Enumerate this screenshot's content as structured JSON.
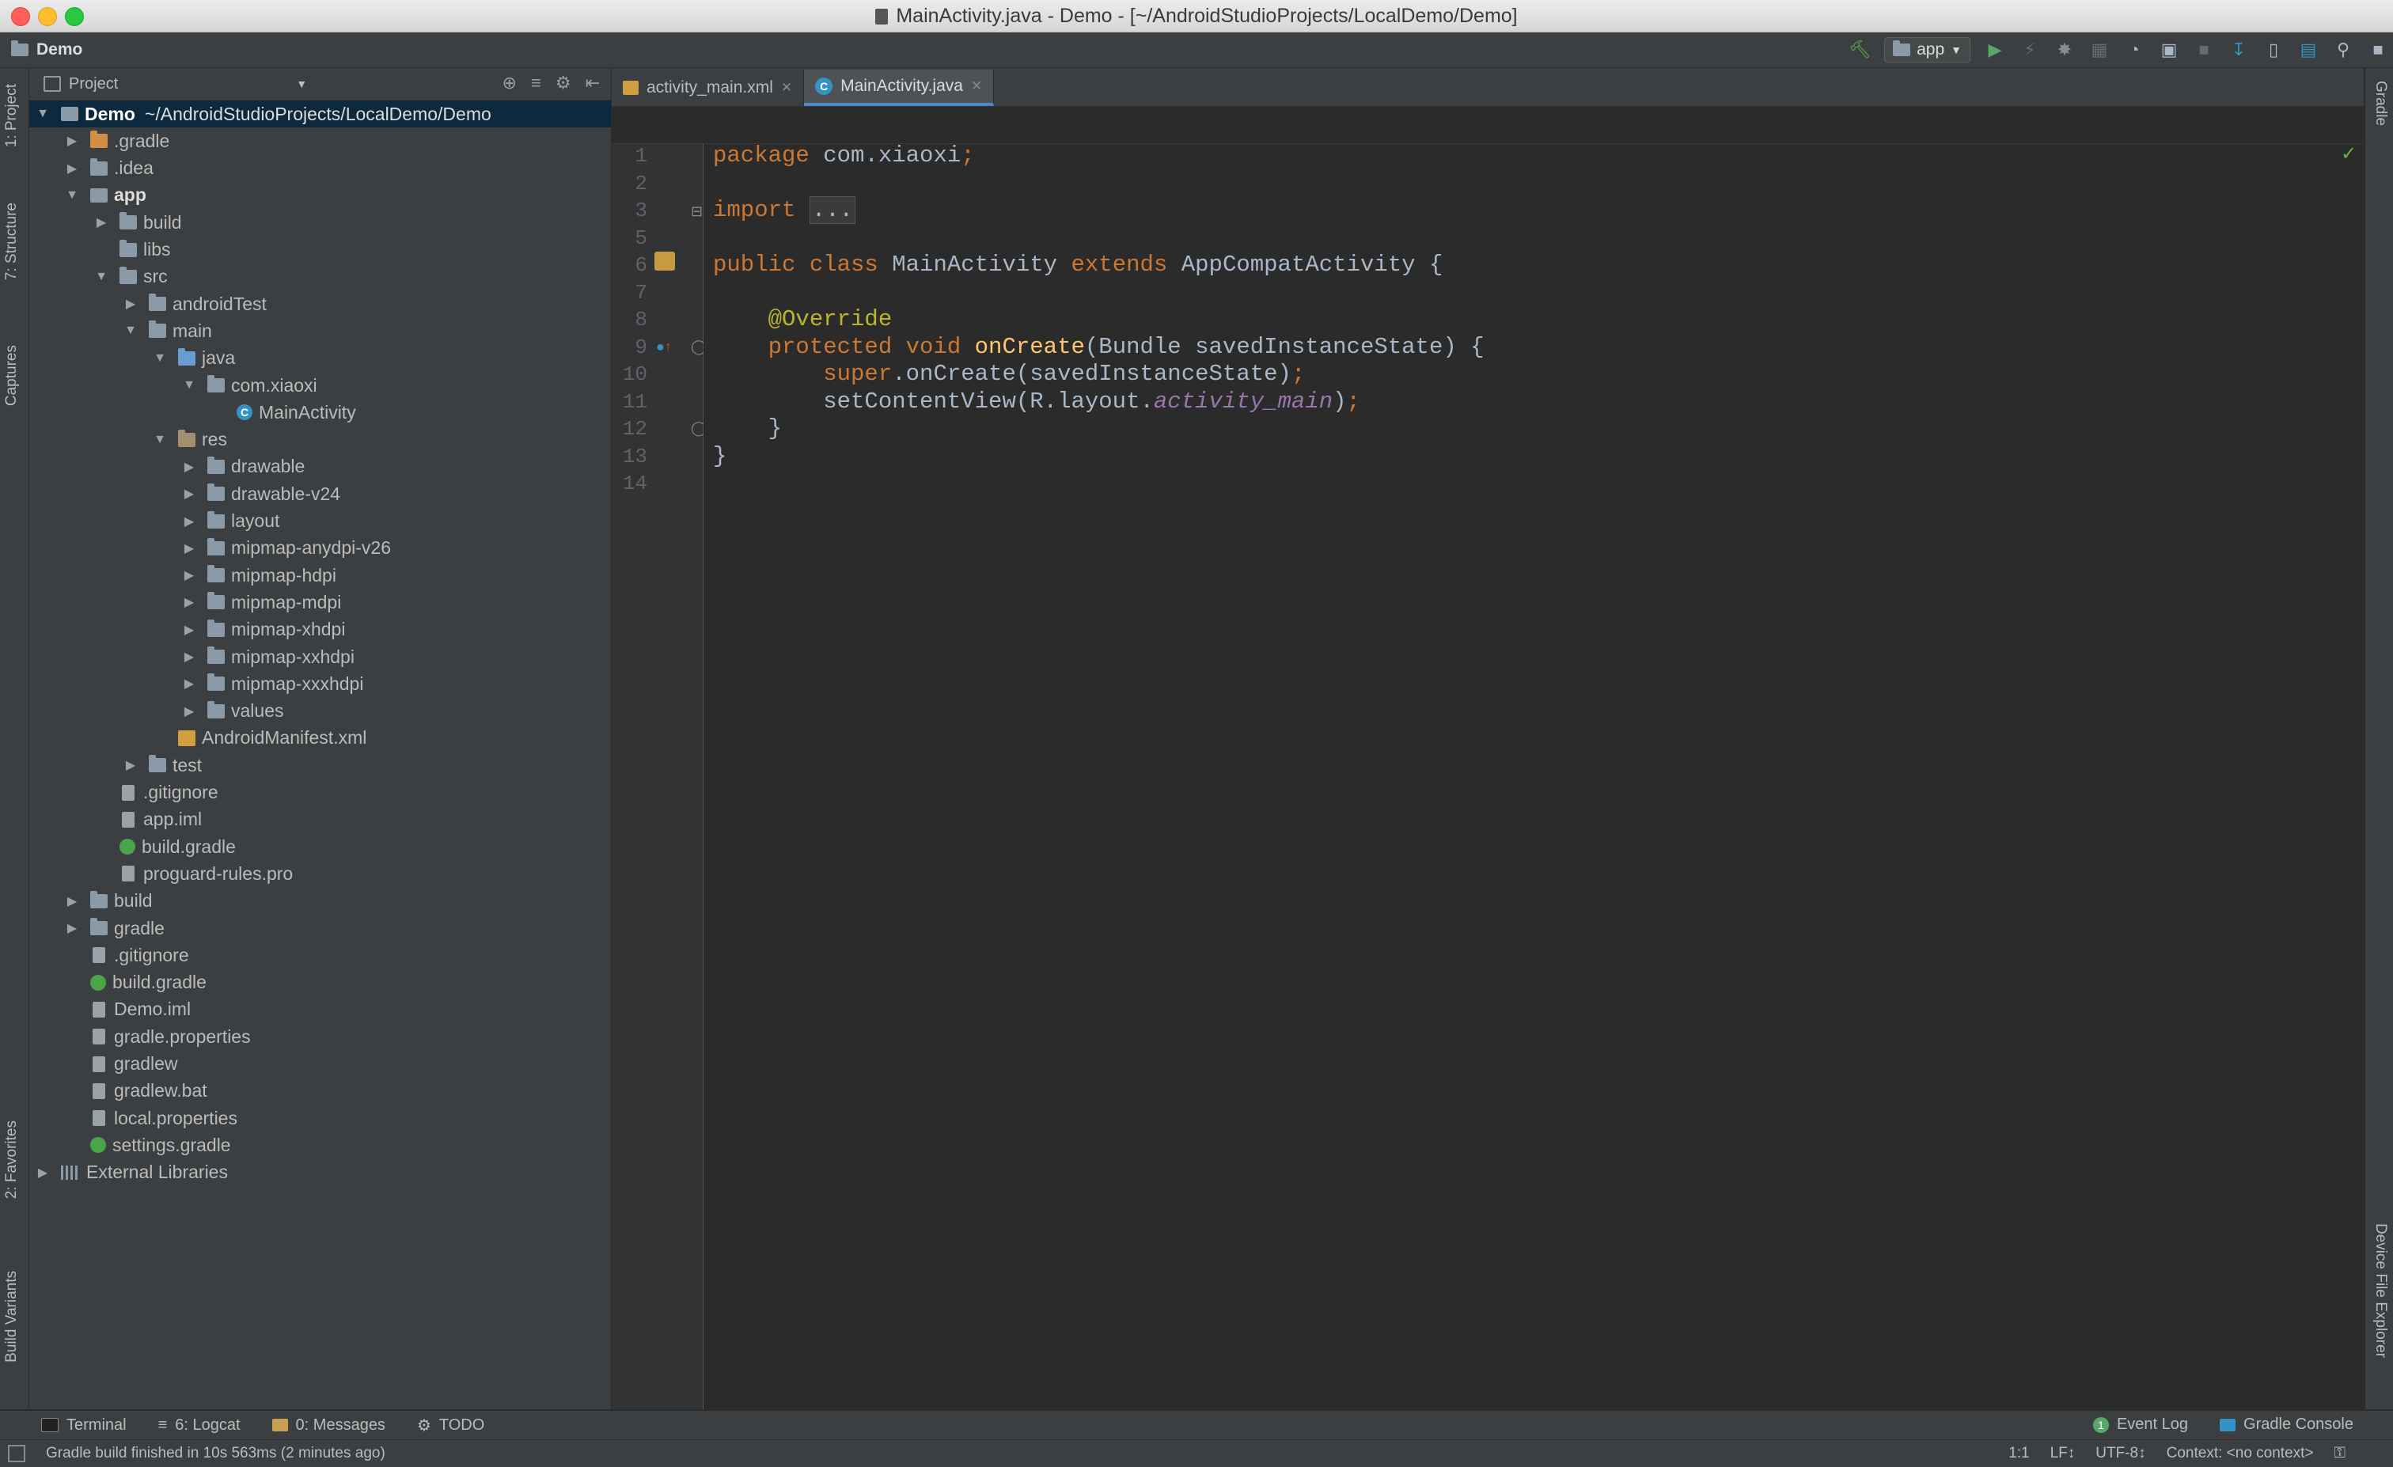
{
  "window": {
    "title": "MainActivity.java - Demo - [~/AndroidStudioProjects/LocalDemo/Demo]"
  },
  "navbar": {
    "breadcrumb": "Demo",
    "run_config": "app"
  },
  "left_strip": {
    "tabs": [
      "1: Project",
      "7: Structure",
      "Captures",
      "2: Favorites",
      "Build Variants"
    ]
  },
  "right_strip": {
    "tabs": [
      "Gradle",
      "Device File Explorer"
    ]
  },
  "project_panel": {
    "title": "Project",
    "tree": [
      {
        "label": "Demo",
        "path": "~/AndroidStudioProjects/LocalDemo/Demo",
        "depth": 0,
        "arrow": "open",
        "icon": "module",
        "bold": true
      },
      {
        "label": ".gradle",
        "depth": 1,
        "arrow": "closed",
        "icon": "folder-orange"
      },
      {
        "label": ".idea",
        "depth": 1,
        "arrow": "closed",
        "icon": "folder"
      },
      {
        "label": "app",
        "depth": 1,
        "arrow": "open",
        "icon": "module",
        "bold": true
      },
      {
        "label": "build",
        "depth": 2,
        "arrow": "closed",
        "icon": "folder"
      },
      {
        "label": "libs",
        "depth": 2,
        "arrow": "none",
        "icon": "folder"
      },
      {
        "label": "src",
        "depth": 2,
        "arrow": "open",
        "icon": "folder"
      },
      {
        "label": "androidTest",
        "depth": 3,
        "arrow": "closed",
        "icon": "folder"
      },
      {
        "label": "main",
        "depth": 3,
        "arrow": "open",
        "icon": "folder"
      },
      {
        "label": "java",
        "depth": 4,
        "arrow": "open",
        "icon": "folder-blue"
      },
      {
        "label": "com.xiaoxi",
        "depth": 5,
        "arrow": "open",
        "icon": "folder"
      },
      {
        "label": "MainActivity",
        "depth": 6,
        "arrow": "none",
        "icon": "class"
      },
      {
        "label": "res",
        "depth": 4,
        "arrow": "open",
        "icon": "folder-res"
      },
      {
        "label": "drawable",
        "depth": 5,
        "arrow": "closed",
        "icon": "folder"
      },
      {
        "label": "drawable-v24",
        "depth": 5,
        "arrow": "closed",
        "icon": "folder"
      },
      {
        "label": "layout",
        "depth": 5,
        "arrow": "closed",
        "icon": "folder"
      },
      {
        "label": "mipmap-anydpi-v26",
        "depth": 5,
        "arrow": "closed",
        "icon": "folder"
      },
      {
        "label": "mipmap-hdpi",
        "depth": 5,
        "arrow": "closed",
        "icon": "folder"
      },
      {
        "label": "mipmap-mdpi",
        "depth": 5,
        "arrow": "closed",
        "icon": "folder"
      },
      {
        "label": "mipmap-xhdpi",
        "depth": 5,
        "arrow": "closed",
        "icon": "folder"
      },
      {
        "label": "mipmap-xxhdpi",
        "depth": 5,
        "arrow": "closed",
        "icon": "folder"
      },
      {
        "label": "mipmap-xxxhdpi",
        "depth": 5,
        "arrow": "closed",
        "icon": "folder"
      },
      {
        "label": "values",
        "depth": 5,
        "arrow": "closed",
        "icon": "folder"
      },
      {
        "label": "AndroidManifest.xml",
        "depth": 4,
        "arrow": "none",
        "icon": "xml"
      },
      {
        "label": "test",
        "depth": 3,
        "arrow": "closed",
        "icon": "folder"
      },
      {
        "label": ".gitignore",
        "depth": 2,
        "arrow": "none",
        "icon": "file"
      },
      {
        "label": "app.iml",
        "depth": 2,
        "arrow": "none",
        "icon": "file"
      },
      {
        "label": "build.gradle",
        "depth": 2,
        "arrow": "none",
        "icon": "gradle"
      },
      {
        "label": "proguard-rules.pro",
        "depth": 2,
        "arrow": "none",
        "icon": "file"
      },
      {
        "label": "build",
        "depth": 1,
        "arrow": "closed",
        "icon": "folder"
      },
      {
        "label": "gradle",
        "depth": 1,
        "arrow": "closed",
        "icon": "folder"
      },
      {
        "label": ".gitignore",
        "depth": 1,
        "arrow": "none",
        "icon": "file"
      },
      {
        "label": "build.gradle",
        "depth": 1,
        "arrow": "none",
        "icon": "gradle"
      },
      {
        "label": "Demo.iml",
        "depth": 1,
        "arrow": "none",
        "icon": "file"
      },
      {
        "label": "gradle.properties",
        "depth": 1,
        "arrow": "none",
        "icon": "file"
      },
      {
        "label": "gradlew",
        "depth": 1,
        "arrow": "none",
        "icon": "file"
      },
      {
        "label": "gradlew.bat",
        "depth": 1,
        "arrow": "none",
        "icon": "file"
      },
      {
        "label": "local.properties",
        "depth": 1,
        "arrow": "none",
        "icon": "file"
      },
      {
        "label": "settings.gradle",
        "depth": 1,
        "arrow": "none",
        "icon": "gradle"
      },
      {
        "label": "External Libraries",
        "depth": 0,
        "arrow": "closed",
        "icon": "lib"
      }
    ]
  },
  "editor": {
    "tabs": [
      {
        "label": "activity_main.xml",
        "active": false
      },
      {
        "label": "MainActivity.java",
        "active": true
      }
    ],
    "lines": [
      {
        "n": "1",
        "tokens": [
          {
            "t": "package ",
            "c": "kw"
          },
          {
            "t": "com.xiaoxi",
            "c": ""
          },
          {
            "t": ";",
            "c": "kw"
          }
        ]
      },
      {
        "n": "2",
        "tokens": []
      },
      {
        "n": "3",
        "tokens": [
          {
            "t": "import ",
            "c": "kw"
          },
          {
            "t": "...",
            "c": "fold"
          }
        ]
      },
      {
        "n": "5",
        "tokens": []
      },
      {
        "n": "6",
        "tokens": [
          {
            "t": "public class ",
            "c": "kw"
          },
          {
            "t": "MainActivity ",
            "c": ""
          },
          {
            "t": "extends ",
            "c": "kw"
          },
          {
            "t": "AppCompatActivity {",
            "c": ""
          }
        ]
      },
      {
        "n": "7",
        "tokens": []
      },
      {
        "n": "8",
        "tokens": [
          {
            "t": "    @Override",
            "c": "ann"
          }
        ]
      },
      {
        "n": "9",
        "tokens": [
          {
            "t": "    protected void ",
            "c": "kw"
          },
          {
            "t": "onCreate",
            "c": "fn"
          },
          {
            "t": "(Bundle savedInstanceState) {",
            "c": ""
          }
        ]
      },
      {
        "n": "10",
        "tokens": [
          {
            "t": "        super",
            "c": "kw"
          },
          {
            "t": ".onCreate(savedInstanceState)",
            "c": ""
          },
          {
            "t": ";",
            "c": "kw"
          }
        ]
      },
      {
        "n": "11",
        "tokens": [
          {
            "t": "        setContentView(R.layout.",
            "c": ""
          },
          {
            "t": "activity_main",
            "c": "it"
          },
          {
            "t": ")",
            "c": ""
          },
          {
            "t": ";",
            "c": "kw"
          }
        ]
      },
      {
        "n": "12",
        "tokens": [
          {
            "t": "    }",
            "c": ""
          }
        ]
      },
      {
        "n": "13",
        "tokens": [
          {
            "t": "}",
            "c": ""
          }
        ]
      },
      {
        "n": "14",
        "tokens": []
      }
    ]
  },
  "bottom_tabs": {
    "left": [
      "Terminal",
      "6: Logcat",
      "0: Messages",
      "TODO"
    ],
    "right": [
      "Event Log",
      "Gradle Console"
    ]
  },
  "status": {
    "message": "Gradle build finished in 10s 563ms (2 minutes ago)",
    "position": "1:1",
    "line_sep": "LF↕",
    "encoding": "UTF-8↕",
    "context": "Context: <no context>"
  }
}
